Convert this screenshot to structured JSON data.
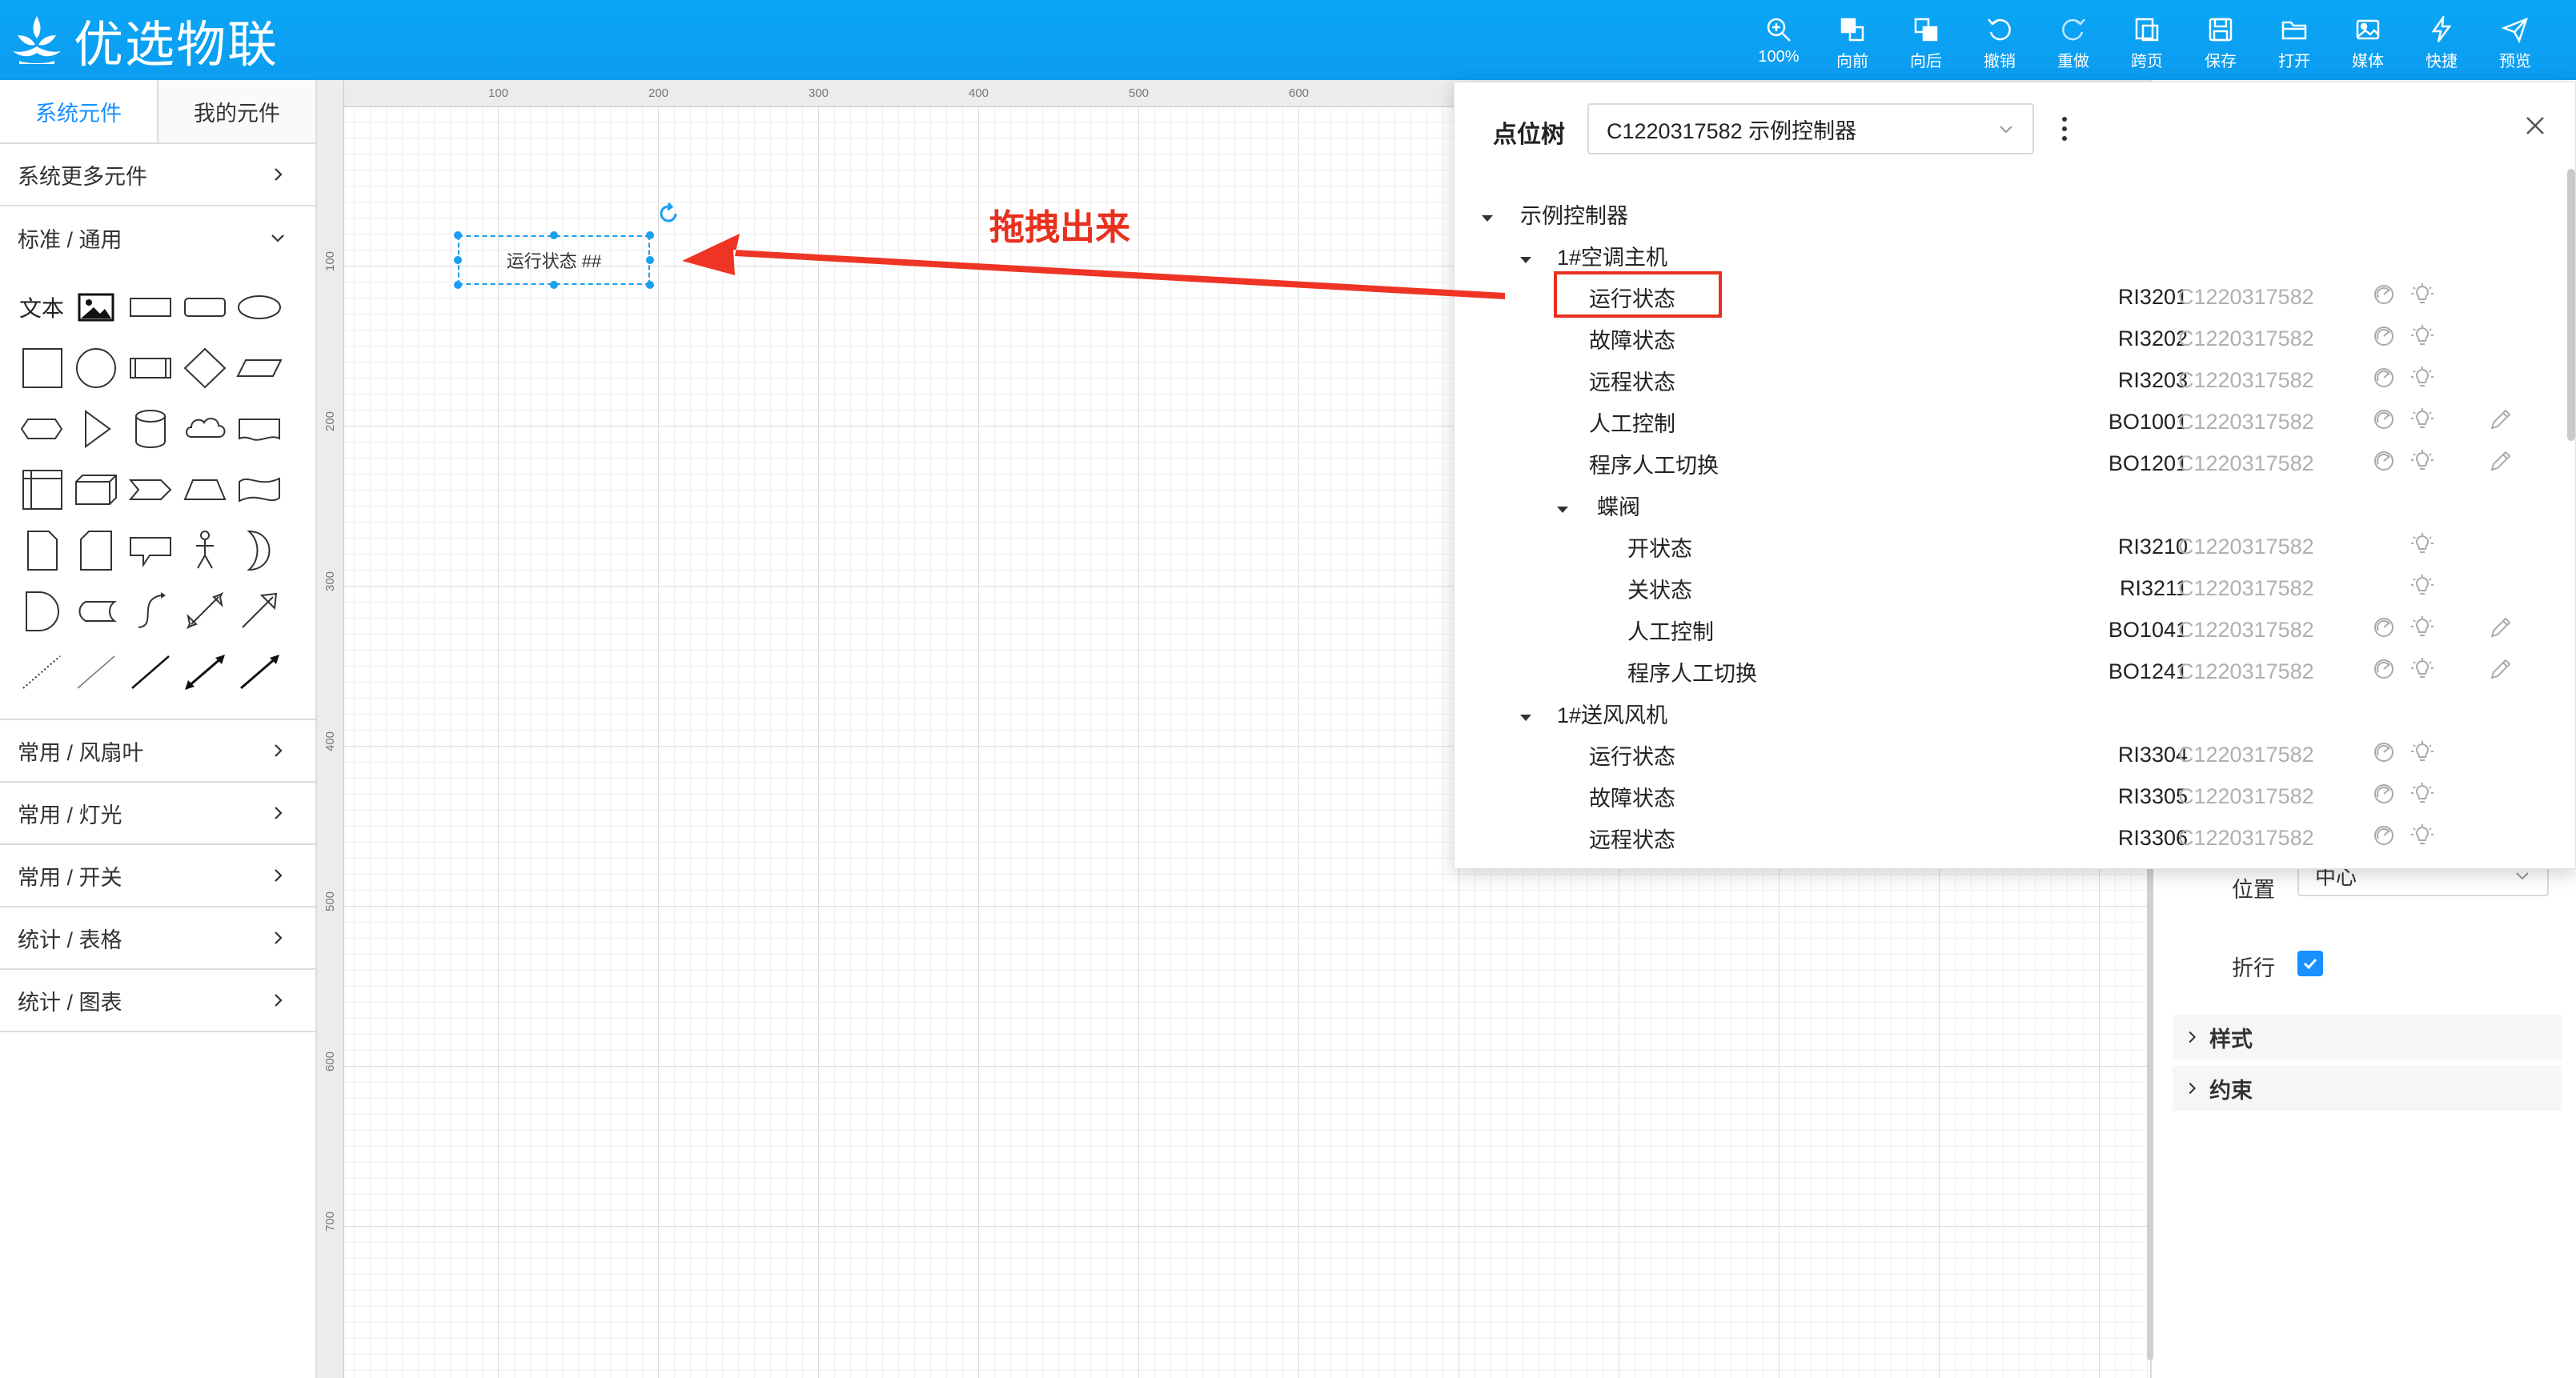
{
  "app": {
    "logo_text": "优选物联"
  },
  "toolbar": [
    {
      "label": "100%",
      "icon": "zoom-icon"
    },
    {
      "label": "向前",
      "icon": "bring-forward-icon"
    },
    {
      "label": "向后",
      "icon": "send-backward-icon"
    },
    {
      "label": "撤销",
      "icon": "undo-icon"
    },
    {
      "label": "重做",
      "icon": "redo-icon"
    },
    {
      "label": "跨页",
      "icon": "cross-page-icon"
    },
    {
      "label": "保存",
      "icon": "save-icon"
    },
    {
      "label": "打开",
      "icon": "open-icon"
    },
    {
      "label": "媒体",
      "icon": "media-icon"
    },
    {
      "label": "快捷",
      "icon": "lightning-icon"
    },
    {
      "label": "预览",
      "icon": "send-icon"
    }
  ],
  "left_panel": {
    "tabs": [
      "系统元件",
      "我的元件"
    ],
    "more_components": "系统更多元件",
    "standard_section": "标准 / 通用",
    "text_shape_label": "文本",
    "categories": [
      "常用 / 风扇叶",
      "常用 / 灯光",
      "常用 / 开关",
      "统计 / 表格",
      "统计 / 图表"
    ]
  },
  "rulers": {
    "h_labels": [
      "100",
      "200",
      "300",
      "400",
      "500",
      "600"
    ],
    "v_labels": [
      "100",
      "200",
      "300",
      "400",
      "500",
      "600",
      "700"
    ]
  },
  "canvas": {
    "element_text": "运行状态 ##",
    "annotation": "拖拽出来"
  },
  "properties": {
    "position_label": "位置",
    "position_value": "中心",
    "wrap_label": "折行",
    "style_section": "样式",
    "constraint_section": "约束"
  },
  "point_tree": {
    "title": "点位树",
    "controller_select": "C1220317582 示例控制器",
    "root": "示例控制器",
    "groups": [
      {
        "name": "1#空调主机",
        "items": [
          {
            "name": "运行状态",
            "code": "RI3201",
            "controller": "C1220317582",
            "editable": false
          },
          {
            "name": "故障状态",
            "code": "RI3202",
            "controller": "C1220317582",
            "editable": false
          },
          {
            "name": "远程状态",
            "code": "RI3203",
            "controller": "C1220317582",
            "editable": false
          },
          {
            "name": "人工控制",
            "code": "BO1001",
            "controller": "C1220317582",
            "editable": true
          },
          {
            "name": "程序人工切换",
            "code": "BO1201",
            "controller": "C1220317582",
            "editable": true
          }
        ],
        "sub": {
          "name": "蝶阀",
          "items": [
            {
              "name": "开状态",
              "code": "RI3210",
              "controller": "C1220317582",
              "editable": false
            },
            {
              "name": "关状态",
              "code": "RI3211",
              "controller": "C1220317582",
              "editable": false
            },
            {
              "name": "人工控制",
              "code": "BO1041",
              "controller": "C1220317582",
              "editable": true
            },
            {
              "name": "程序人工切换",
              "code": "BO1241",
              "controller": "C1220317582",
              "editable": true
            }
          ]
        }
      },
      {
        "name": "1#送风风机",
        "items": [
          {
            "name": "运行状态",
            "code": "RI3304",
            "controller": "C1220317582",
            "editable": false
          },
          {
            "name": "故障状态",
            "code": "RI3305",
            "controller": "C1220317582",
            "editable": false
          },
          {
            "name": "远程状态",
            "code": "RI3306",
            "controller": "C1220317582",
            "editable": false
          }
        ]
      }
    ]
  },
  "colors": {
    "accent": "#1890ff",
    "topbar": "#0aa6f5",
    "annotation": "#e8301f"
  }
}
